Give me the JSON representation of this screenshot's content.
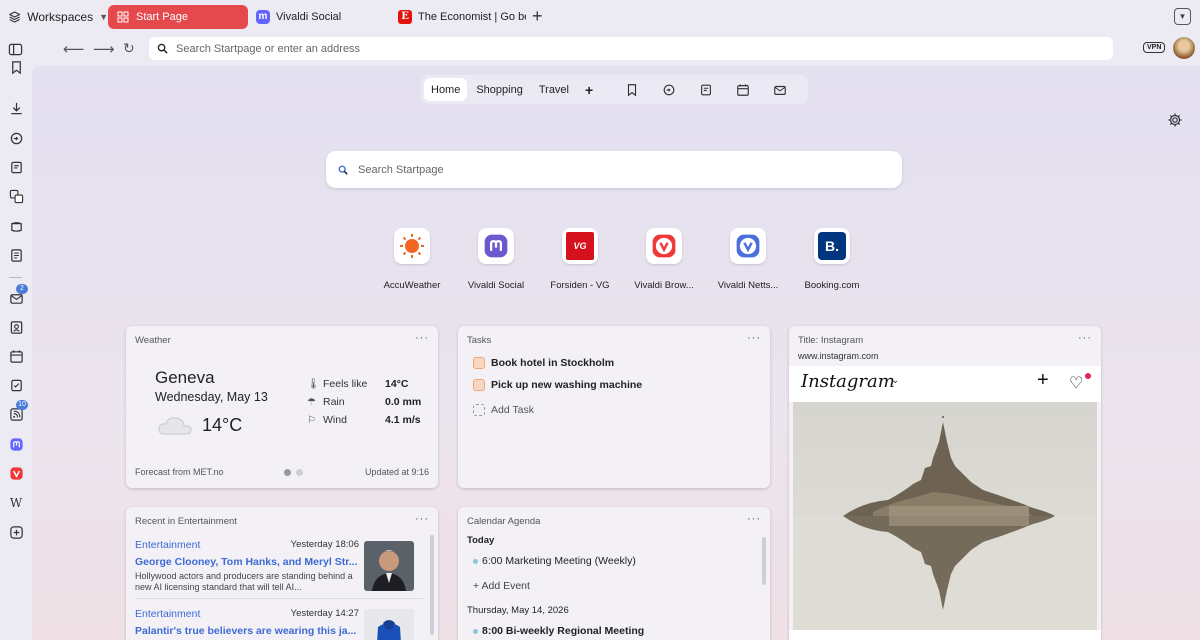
{
  "tabbar": {
    "workspaces_label": "Workspaces",
    "tabs": [
      {
        "label": "Start Page",
        "icon": "grid-icon"
      },
      {
        "label": "Vivaldi Social",
        "icon": "mastodon-icon"
      },
      {
        "label": "The Economist | Go beyon",
        "icon": "economist-icon"
      }
    ]
  },
  "addressbar": {
    "placeholder": "Search Startpage or enter an address",
    "vpn_label": "VPN"
  },
  "sidebar": {
    "badges": {
      "mail": "2",
      "feeds": "10"
    },
    "wiki_glyph": "W"
  },
  "dialnav": {
    "tabs": [
      "Home",
      "Shopping",
      "Travel"
    ],
    "add_label": "+"
  },
  "search": {
    "placeholder": "Search Startpage"
  },
  "speed_dials": [
    {
      "label": "AccuWeather",
      "color": "#f26522"
    },
    {
      "label": "Vivaldi Social",
      "color": "#6a5acd"
    },
    {
      "label": "Forsiden - VG",
      "color": "#d6111e",
      "glyph": "VG"
    },
    {
      "label": "Vivaldi Brow...",
      "color": "#ef3939"
    },
    {
      "label": "Vivaldi Netts...",
      "color": "#4a6fdc"
    },
    {
      "label": "Booking.com",
      "color": "#003580",
      "glyph": "B."
    }
  ],
  "weather": {
    "title": "Weather",
    "city": "Geneva",
    "date": "Wednesday, May 13",
    "temp": "14°C",
    "feels_label": "Feels like",
    "feels_value": "14°C",
    "rain_label": "Rain",
    "rain_value": "0.0 mm",
    "wind_label": "Wind",
    "wind_value": "4.1 m/s",
    "source": "Forecast from MET.no",
    "updated": "Updated at 9:16"
  },
  "tasks": {
    "title": "Tasks",
    "items": [
      "Book hotel in Stockholm",
      "Pick up new washing machine"
    ],
    "add_label": "Add Task"
  },
  "instagram": {
    "title": "Title: Instagram",
    "url": "www.instagram.com",
    "logo": "Instagram"
  },
  "news": {
    "title": "Recent in Entertainment",
    "items": [
      {
        "category": "Entertainment",
        "time": "Yesterday 18:06",
        "headline": "George Clooney, Tom Hanks, and Meryl Str...",
        "summary": "Hollywood actors and producers are standing behind a new AI licensing standard that will tell AI..."
      },
      {
        "category": "Entertainment",
        "time": "Yesterday 14:27",
        "headline": "Palantir's true believers are wearing this ja..."
      }
    ]
  },
  "calendar": {
    "title": "Calendar Agenda",
    "today_label": "Today",
    "event1": "6:00 Marketing Meeting (Weekly)",
    "add_label": "+ Add Event",
    "next_day": "Thursday,  May 14, 2026",
    "event2": "8:00 Bi-weekly Regional Meeting"
  },
  "more_glyph": "···"
}
